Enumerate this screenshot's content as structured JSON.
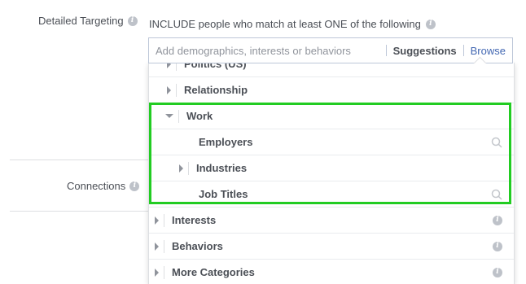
{
  "labels": {
    "detailed_targeting": "Detailed Targeting",
    "connections": "Connections"
  },
  "targeting": {
    "include_text": "INCLUDE people who match at least ONE of the following",
    "search_placeholder": "Add demographics, interests or behaviors",
    "suggestions_label": "Suggestions",
    "browse_label": "Browse"
  },
  "tree": {
    "rows": [
      {
        "label": "Politics (US)",
        "state": "collapsed"
      },
      {
        "label": "Relationship",
        "state": "collapsed"
      },
      {
        "label": "Work",
        "state": "expanded"
      },
      {
        "label": "Employers",
        "state": "leaf",
        "icon": "search-icon"
      },
      {
        "label": "Industries",
        "state": "collapsed"
      },
      {
        "label": "Job Titles",
        "state": "leaf",
        "icon": "search-icon"
      },
      {
        "label": "Interests",
        "state": "collapsed",
        "icon": "info-icon"
      },
      {
        "label": "Behaviors",
        "state": "collapsed",
        "icon": "info-icon"
      },
      {
        "label": "More Categories",
        "state": "collapsed",
        "icon": "info-icon"
      }
    ]
  },
  "colors": {
    "accent": "#4267b2",
    "highlight": "#22cc22",
    "text": "#4b4f56"
  }
}
